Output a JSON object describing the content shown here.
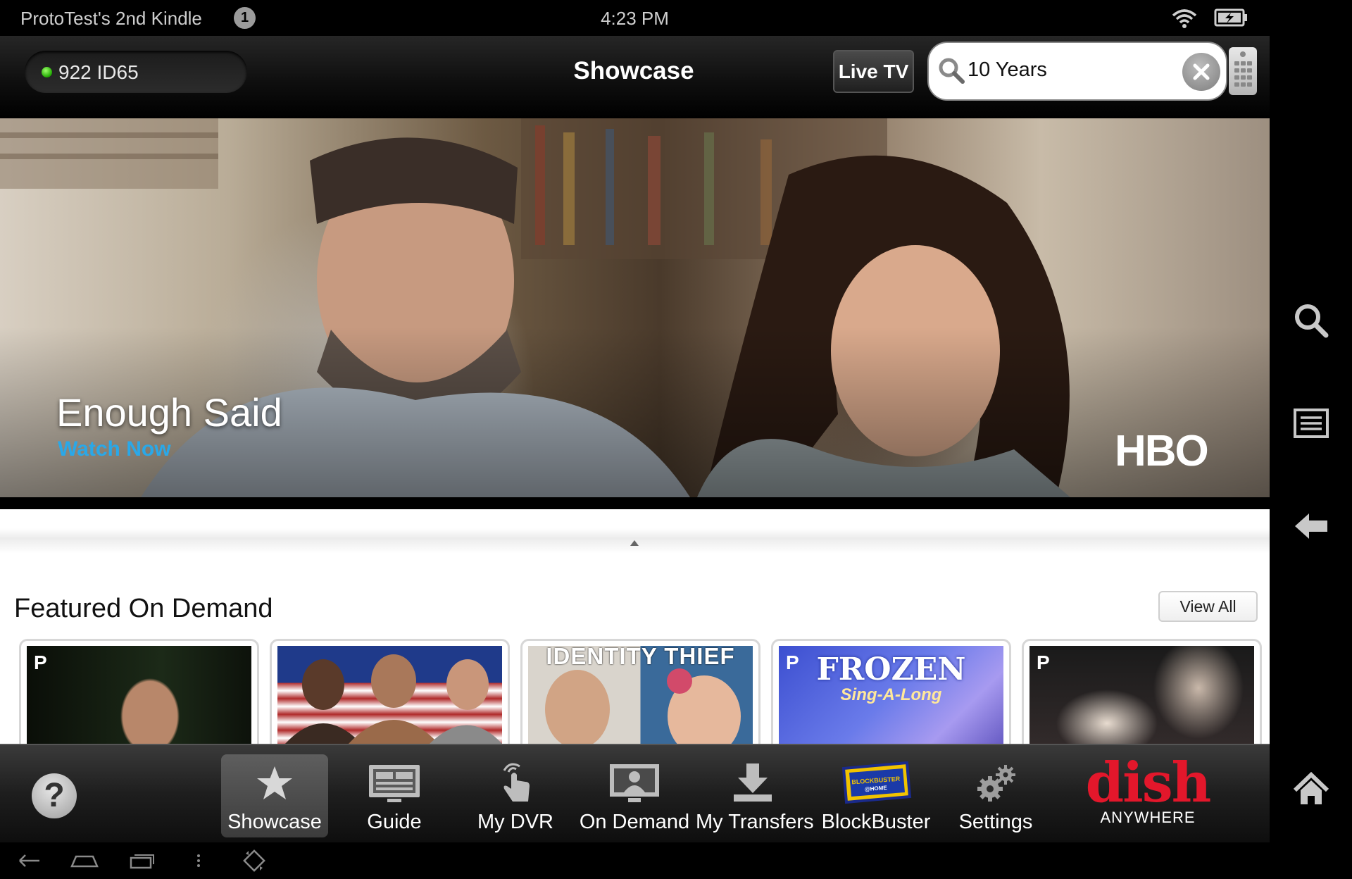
{
  "status_bar": {
    "device_name": "ProtoTest's 2nd Kindle",
    "notification_count": "1",
    "time": "4:23 PM"
  },
  "header": {
    "receiver_label": "922 ID65",
    "title": "Showcase",
    "live_tv_label": "Live TV",
    "search_value": "10 Years"
  },
  "hero": {
    "title": "Enough Said",
    "cta": "Watch Now",
    "network": "HBO"
  },
  "featured": {
    "heading": "Featured On Demand",
    "view_all_label": "View All",
    "items": [
      {
        "badge": "P",
        "overlay_text": ""
      },
      {
        "badge": "",
        "overlay_text": ""
      },
      {
        "badge": "",
        "overlay_text": "IDENTITY THIEF"
      },
      {
        "badge": "P",
        "overlay_text": "FROZEN",
        "overlay_sub": "Sing-A-Long"
      },
      {
        "badge": "P",
        "overlay_text": ""
      }
    ]
  },
  "tabs": [
    {
      "label": "Showcase",
      "icon": "star-icon",
      "active": true
    },
    {
      "label": "Guide",
      "icon": "guide-icon",
      "active": false
    },
    {
      "label": "My DVR",
      "icon": "touch-icon",
      "active": false
    },
    {
      "label": "On Demand",
      "icon": "on-demand-icon",
      "active": false
    },
    {
      "label": "My Transfers",
      "icon": "download-icon",
      "active": false
    },
    {
      "label": "BlockBuster",
      "icon": "blockbuster-icon",
      "active": false
    },
    {
      "label": "Settings",
      "icon": "gear-icon",
      "active": false
    }
  ],
  "help_label": "?",
  "brand": {
    "name": "dish",
    "tagline": "ANYWHERE",
    "color": "#e3172b"
  },
  "blockbuster_badge": "BLOCKBUSTER @HOME",
  "colors": {
    "accent": "#2aa8e8",
    "live_dot": "#1fa800"
  }
}
